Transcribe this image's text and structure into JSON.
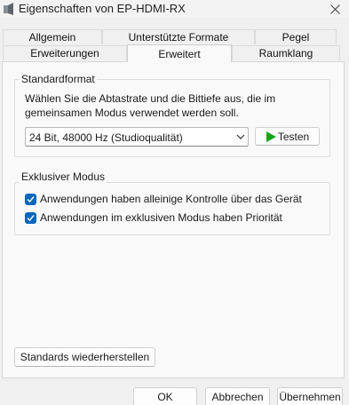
{
  "window": {
    "title": "Eigenschaften von EP-HDMI-RX"
  },
  "tabs_row1": [
    {
      "label": "Allgemein"
    },
    {
      "label": "Unterstützte Formate"
    },
    {
      "label": "Pegel"
    }
  ],
  "tabs_row2": [
    {
      "label": "Erweiterungen"
    },
    {
      "label": "Erweitert",
      "active": true
    },
    {
      "label": "Raumklang"
    }
  ],
  "standard_format": {
    "group_title": "Standardformat",
    "description_line1": "Wählen Sie die Abtastrate und die Bittiefe aus, die im",
    "description_line2": "gemeinsamen Modus verwendet werden soll.",
    "selected_format": "24 Bit, 48000 Hz (Studioqualität)",
    "test_button": "Testen"
  },
  "exclusive_mode": {
    "group_title": "Exklusiver Modus",
    "options": [
      {
        "label": "Anwendungen haben alleinige Kontrolle über das Gerät",
        "checked": true
      },
      {
        "label": "Anwendungen im exklusiven Modus haben Priorität",
        "checked": true
      }
    ]
  },
  "restore_defaults_button": "Standards wiederherstellen",
  "footer": {
    "ok": "OK",
    "cancel": "Abbrechen",
    "apply": "Übernehmen"
  },
  "colors": {
    "accent": "#0067c0",
    "play_green": "#16a516"
  },
  "icons": {
    "app": "speaker-icon",
    "close": "close-icon",
    "combo": "chevron-down-icon",
    "test": "play-icon",
    "check": "checkmark-icon"
  }
}
